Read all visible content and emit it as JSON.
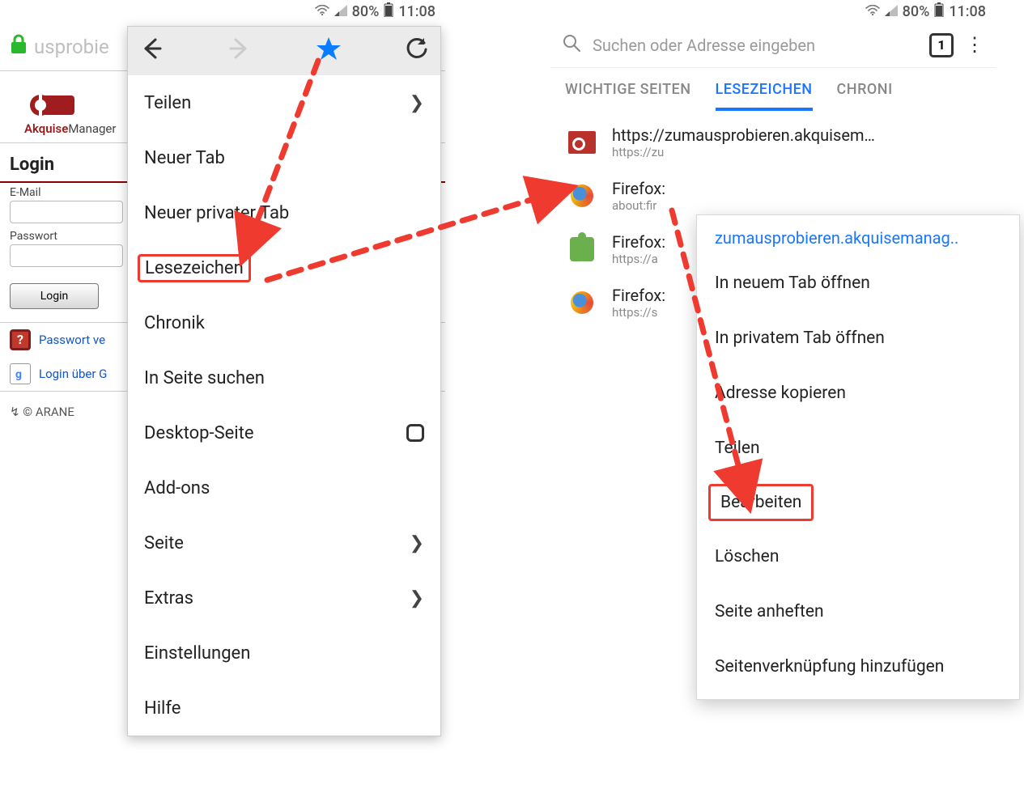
{
  "status": {
    "battery": "80%",
    "time": "11:08"
  },
  "left": {
    "url_fragment": "usprobie",
    "logo_text_1": "Akquise",
    "logo_text_2": "Manager",
    "login_heading": "Login",
    "field_email": "E-Mail",
    "field_password": "Passwort",
    "login_button": "Login",
    "forgot_link": "Passwort ve",
    "google_link": "Login über G",
    "footer": "© ARANE"
  },
  "menu": {
    "teilen": "Teilen",
    "neuer_tab": "Neuer Tab",
    "neuer_privater": "Neuer privater Tab",
    "lesezeichen": "Lesezeichen",
    "chronik": "Chronik",
    "in_seite": "In Seite suchen",
    "desktop": "Desktop-Seite",
    "addons": "Add-ons",
    "seite": "Seite",
    "extras": "Extras",
    "einstellungen": "Einstellungen",
    "hilfe": "Hilfe"
  },
  "right": {
    "search_placeholder": "Suchen oder Adresse eingeben",
    "tab_count": "1",
    "tabs": {
      "wichtige": "WICHTIGE SEITEN",
      "lesezeichen": "LESEZEICHEN",
      "chronik": "CHRONI"
    },
    "bookmarks": [
      {
        "title": "https://zumausprobieren.akquisem…",
        "sub": "https://zu"
      },
      {
        "title": "Firefox:",
        "sub": "about:fir"
      },
      {
        "title": "Firefox:",
        "sub": "https://a"
      },
      {
        "title": "Firefox:",
        "sub": "https://s"
      }
    ]
  },
  "ctx": {
    "title": "zumausprobieren.akquisemanag..",
    "open_new": "In neuem Tab öffnen",
    "open_priv": "In privatem Tab öffnen",
    "copy": "Adresse kopieren",
    "share": "Teilen",
    "edit": "Bearbeiten",
    "delete": "Löschen",
    "pin": "Seite anheften",
    "shortcut": "Seitenverknüpfung hinzufügen"
  }
}
